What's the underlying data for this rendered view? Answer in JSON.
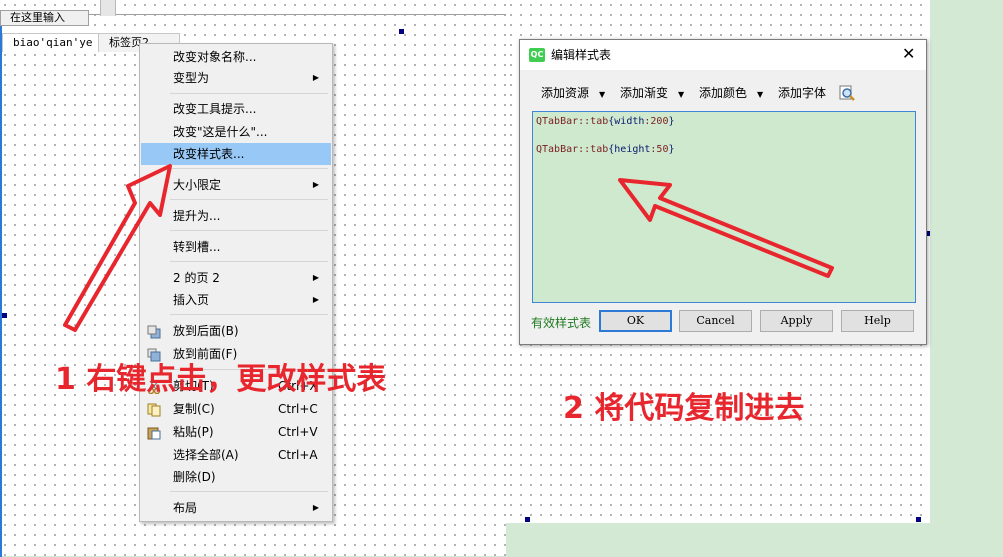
{
  "designer": {
    "top_input": "在这里输入",
    "tabs": [
      "biao'qian'ye",
      "标签页2"
    ]
  },
  "context_menu": {
    "items": [
      {
        "label": "改变对象名称...",
        "shortcut": "",
        "submenu": false
      },
      {
        "label": "变型为",
        "shortcut": "",
        "submenu": true
      },
      {
        "label": "改变工具提示...",
        "shortcut": "",
        "submenu": false
      },
      {
        "label": "改变\"这是什么\"...",
        "shortcut": "",
        "submenu": false
      },
      {
        "label": "改变样式表...",
        "shortcut": "",
        "submenu": false,
        "highlighted": true
      },
      {
        "label": "大小限定",
        "shortcut": "",
        "submenu": true
      },
      {
        "label": "提升为...",
        "shortcut": "",
        "submenu": false
      },
      {
        "label": "转到槽...",
        "shortcut": "",
        "submenu": false
      },
      {
        "label": "2 的页 2",
        "shortcut": "",
        "submenu": true
      },
      {
        "label": "插入页",
        "shortcut": "",
        "submenu": true
      },
      {
        "label": "放到后面(B)",
        "shortcut": "",
        "submenu": false,
        "icon": "send-to-back-icon"
      },
      {
        "label": "放到前面(F)",
        "shortcut": "",
        "submenu": false,
        "icon": "bring-to-front-icon"
      },
      {
        "label": "剪切(T)",
        "shortcut": "Ctrl+X",
        "submenu": false,
        "icon": "scissors-icon"
      },
      {
        "label": "复制(C)",
        "shortcut": "Ctrl+C",
        "submenu": false,
        "icon": "copy-icon"
      },
      {
        "label": "粘贴(P)",
        "shortcut": "Ctrl+V",
        "submenu": false,
        "icon": "paste-icon"
      },
      {
        "label": "选择全部(A)",
        "shortcut": "Ctrl+A",
        "submenu": false
      },
      {
        "label": "删除(D)",
        "shortcut": "",
        "submenu": false
      },
      {
        "label": "布局",
        "shortcut": "",
        "submenu": true
      }
    ]
  },
  "dialog": {
    "title": "编辑样式表",
    "logo_text": "QC",
    "close_glyph": "✕",
    "toolbar": {
      "add_resource": "添加资源",
      "add_gradient": "添加渐变",
      "add_color": "添加颜色",
      "add_font": "添加字体"
    },
    "code": [
      {
        "selector": "QTabBar::tab",
        "open": "{",
        "prop": "width",
        "value": ":200",
        "close": "}"
      },
      {
        "selector": "QTabBar::tab",
        "open": "{",
        "prop": "height",
        "value": ":50",
        "close": "}"
      }
    ],
    "status": "有效样式表",
    "buttons": {
      "ok": "OK",
      "cancel": "Cancel",
      "apply": "Apply",
      "help": "Help"
    }
  },
  "annotations": {
    "step1": "1 右键点击，更改样式表",
    "step2": "2 将代码复制进去"
  },
  "colors": {
    "annotation": "#e8262d",
    "highlight": "#98c8f6",
    "editor_bg": "#cfe9cf"
  }
}
